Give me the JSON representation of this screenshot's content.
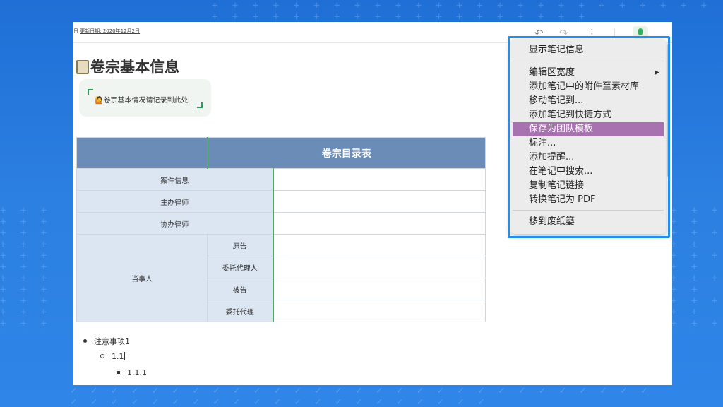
{
  "toolbar": {
    "update_prefix": "日",
    "update_date": "更新日期: 2020年12月2日",
    "undo_icon": "↶",
    "redo_icon": "↷",
    "more_icon": "⋮"
  },
  "document": {
    "title": "卷宗基本信息",
    "callout_text": "🙋卷宗基本情况请记录到此处",
    "table": {
      "header": "卷宗目录表",
      "rows": {
        "case_info": "案件信息",
        "lead_lawyer": "主办律师",
        "assist_lawyer": "协办律师",
        "party": "当事人",
        "plaintiff": "原告",
        "plaintiff_agent": "委托代理人",
        "defendant": "被告",
        "defendant_agent": "委托代理"
      }
    },
    "bullets": {
      "level1": "注意事项1",
      "level2": "1.1",
      "level3": "1.1.1"
    }
  },
  "context_menu": {
    "items": [
      "显示笔记信息",
      "编辑区宽度",
      "添加笔记中的附件至素材库",
      "移动笔记到...",
      "添加笔记到快捷方式",
      "保存为团队模板",
      "标注...",
      "添加提醒...",
      "在笔记中搜索...",
      "复制笔记链接",
      "转换笔记为 PDF",
      "移到废纸篓"
    ],
    "submenu_arrow": "▶",
    "highlighted_item": "保存为团队模板"
  },
  "colors": {
    "background": "#2b7fe0",
    "highlight": "#a872b0",
    "table_header": "#6c8cb8",
    "table_label": "#dce6f2",
    "frame": "#1f8ef1"
  }
}
